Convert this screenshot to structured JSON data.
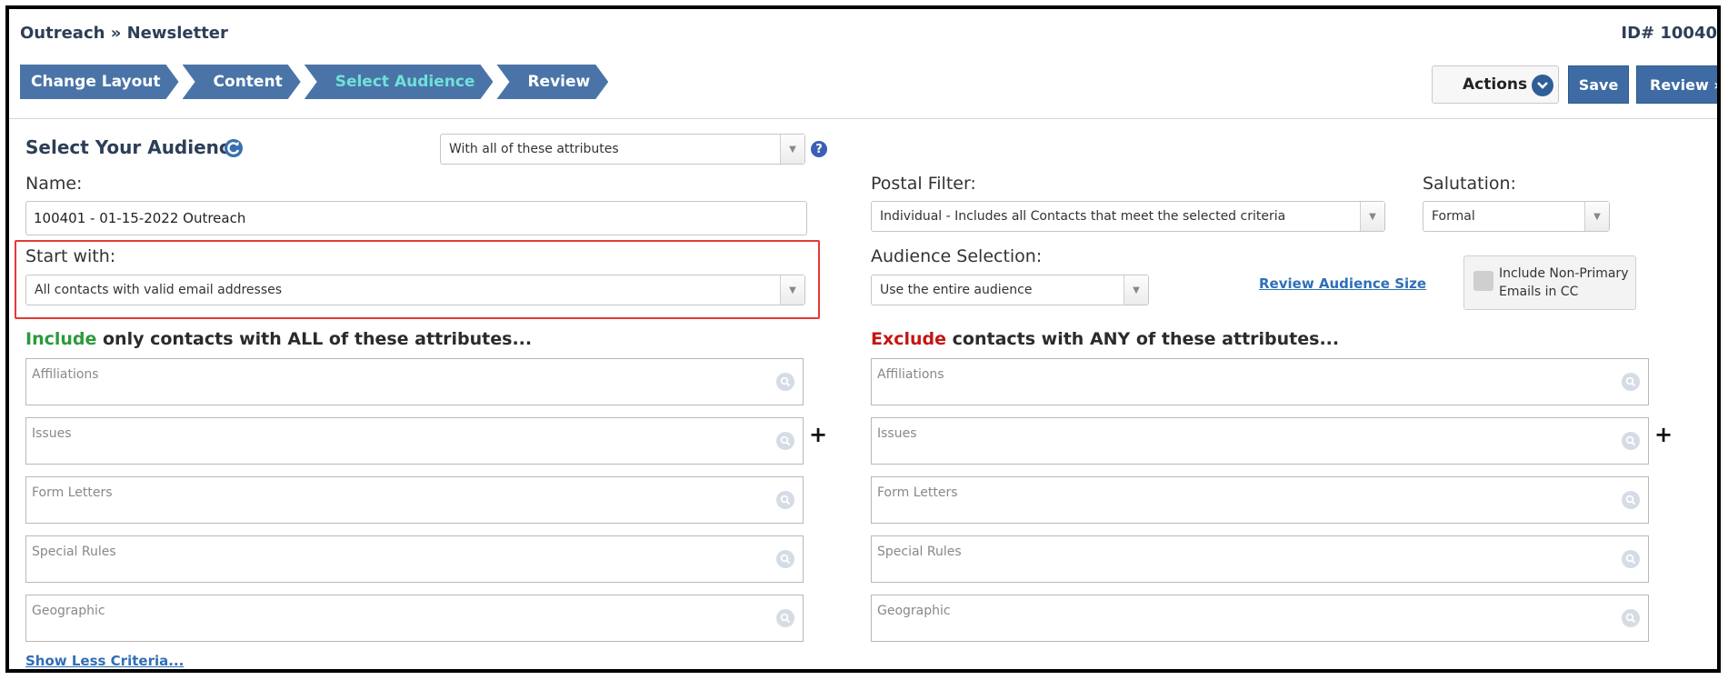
{
  "header": {
    "breadcrumb": "Outreach » Newsletter",
    "record_id": "ID# 10040"
  },
  "steps": [
    {
      "label": "Change Layout",
      "active": false
    },
    {
      "label": "Content",
      "active": false
    },
    {
      "label": "Select Audience",
      "active": true
    },
    {
      "label": "Review",
      "active": false
    }
  ],
  "toolbar": {
    "actions_label": "Actions",
    "save_label": "Save",
    "review_label": "Review »"
  },
  "audience": {
    "title": "Select Your Audience",
    "match_mode": "With all of these attributes",
    "name_label": "Name:",
    "name_value": "100401 - 01-15-2022 Outreach",
    "start_with_label": "Start with:",
    "start_with_value": "All contacts with valid email addresses"
  },
  "postal": {
    "label": "Postal Filter:",
    "value": "Individual - Includes all Contacts that meet the selected criteria"
  },
  "salutation": {
    "label": "Salutation:",
    "value": "Formal"
  },
  "audience_selection": {
    "label": "Audience Selection:",
    "value": "Use the entire audience",
    "review_size_link": "Review Audience Size",
    "non_primary_label": "Include Non-Primary Emails in CC"
  },
  "include": {
    "keyword": "Include",
    "heading_rest": " only contacts with ALL of these attributes...",
    "fields": [
      "Affiliations",
      "Issues",
      "Form Letters",
      "Special Rules",
      "Geographic"
    ]
  },
  "exclude": {
    "keyword": "Exclude",
    "heading_rest": " contacts with ANY of these attributes...",
    "fields": [
      "Affiliations",
      "Issues",
      "Form Letters",
      "Special Rules",
      "Geographic"
    ]
  },
  "show_less_link": "Show Less Criteria..."
}
